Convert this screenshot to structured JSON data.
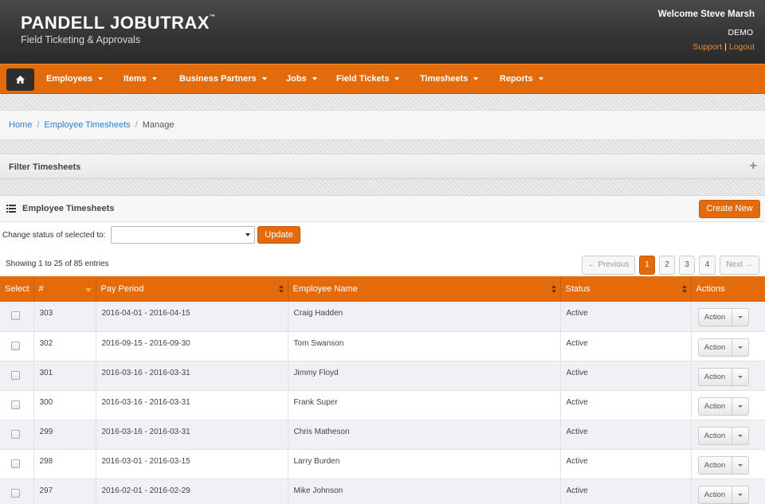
{
  "header": {
    "brand": "PANDELL JOBUTRAX",
    "brand_mark": "™",
    "tagline": "Field Ticketing & Approvals",
    "welcome": "Welcome Steve Marsh",
    "role": "DEMO",
    "support_label": "Support",
    "logout_label": "Logout"
  },
  "nav": {
    "items": [
      "Employees",
      "Items",
      "Business Partners",
      "Jobs",
      "Field Tickets",
      "Timesheets",
      "Reports"
    ]
  },
  "breadcrumb": [
    "Home",
    "Employee Timesheets",
    "Manage"
  ],
  "filter": {
    "title": "Filter Timesheets",
    "toggle": "+"
  },
  "panel": {
    "title": "Employee Timesheets",
    "create_label": "Create New",
    "change_status_label": "Change status of selected to:",
    "status_value": "",
    "update_label": "Update",
    "showing": "Showing 1 to 25 of 85 entries",
    "pager": {
      "prev": "← Previous",
      "next": "Next →",
      "pages": [
        "1",
        "2",
        "3",
        "4"
      ],
      "current": "1"
    }
  },
  "table": {
    "columns": [
      "Select",
      "#",
      "Pay Period",
      "Employee Name",
      "Status",
      "Actions"
    ],
    "action_label": "Action",
    "rows": [
      {
        "id": "303",
        "period": "2016-04-01 - 2016-04-15",
        "name": "Craig Hadden",
        "status": "Active"
      },
      {
        "id": "302",
        "period": "2016-09-15 - 2016-09-30",
        "name": "Tom Swanson",
        "status": "Active"
      },
      {
        "id": "301",
        "period": "2016-03-16 - 2016-03-31",
        "name": "Jimmy Floyd",
        "status": "Active"
      },
      {
        "id": "300",
        "period": "2016-03-16 - 2016-03-31",
        "name": "Frank Super",
        "status": "Active"
      },
      {
        "id": "299",
        "period": "2016-03-16 - 2016-03-31",
        "name": "Chris Matheson",
        "status": "Active"
      },
      {
        "id": "298",
        "period": "2016-03-01 - 2016-03-15",
        "name": "Larry Burden",
        "status": "Active"
      },
      {
        "id": "297",
        "period": "2016-02-01 - 2016-02-29",
        "name": "Mike Johnson",
        "status": "Active"
      }
    ]
  }
}
